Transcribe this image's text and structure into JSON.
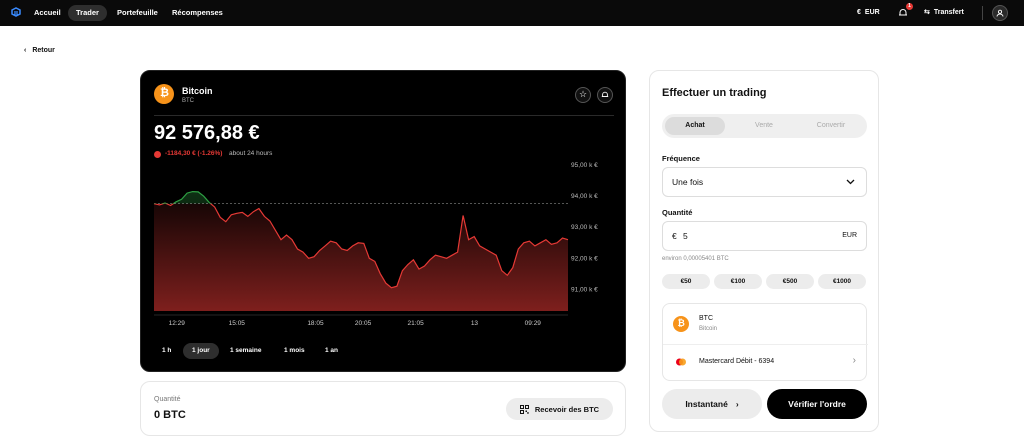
{
  "nav": {
    "items": [
      "Accueil",
      "Trader",
      "Portefeuille",
      "Récompenses"
    ],
    "currency": "EUR",
    "notif_count": "1",
    "transfer": "Transfert"
  },
  "back_label": "Retour",
  "asset": {
    "name": "Bitcoin",
    "ticker": "BTC",
    "price": "92 576,88 €",
    "delta": "-1184,30 € (-1.26%)",
    "delta_period": "about 24 hours"
  },
  "chart_data": {
    "type": "line",
    "x_ticks": [
      "12:29",
      "15:05",
      "18:05",
      "20:05",
      "21:05",
      "13",
      "09:29"
    ],
    "y_ticks": [
      "95,00 k €",
      "94,00 k €",
      "93,00 k €",
      "92,00 k €",
      "91,00 k €"
    ],
    "ylim": [
      90300,
      95200
    ],
    "reference_value": 93760,
    "values": [
      93760,
      93720,
      93780,
      93700,
      93820,
      93900,
      94100,
      94150,
      94140,
      94000,
      93800,
      93650,
      93320,
      93180,
      93400,
      93450,
      93480,
      93350,
      93500,
      93600,
      93350,
      93200,
      92900,
      92600,
      92750,
      92600,
      92300,
      92200,
      92000,
      92050,
      92250,
      92400,
      92550,
      92500,
      92300,
      92250,
      92400,
      92500,
      92480,
      92000,
      91900,
      91500,
      91200,
      91050,
      91100,
      91600,
      91800,
      91950,
      91650,
      91750,
      91950,
      92100,
      92050,
      92000,
      92100,
      92200,
      93380,
      92600,
      92700,
      92400,
      92300,
      92200,
      92100,
      91600,
      91450,
      91700,
      92300,
      92500,
      92550,
      92400,
      92500,
      92600,
      92450,
      92500,
      92650,
      92600
    ],
    "colors": {
      "up": "#2ea043",
      "down": "#e53935"
    }
  },
  "timeframes": [
    "1 h",
    "1 jour",
    "1 semaine",
    "1 mois",
    "1 an"
  ],
  "holdings": {
    "label": "Quantité",
    "value": "0 BTC",
    "receive": "Recevoir des BTC"
  },
  "trade": {
    "title": "Effectuer un trading",
    "tabs": [
      "Achat",
      "Vente",
      "Convertir"
    ],
    "frequency_label": "Fréquence",
    "frequency_value": "Une fois",
    "quantity_label": "Quantité",
    "amount_symbol": "€",
    "amount_value": "5",
    "amount_currency": "EUR",
    "approx": "environ 0,00005401 BTC",
    "chips": [
      "€50",
      "€100",
      "€500",
      "€1000"
    ],
    "asset_ticker": "BTC",
    "asset_name": "Bitcoin",
    "payment": "Mastercard Débit - 6394",
    "instant": "Instantané",
    "verify": "Vérifier l'ordre"
  }
}
